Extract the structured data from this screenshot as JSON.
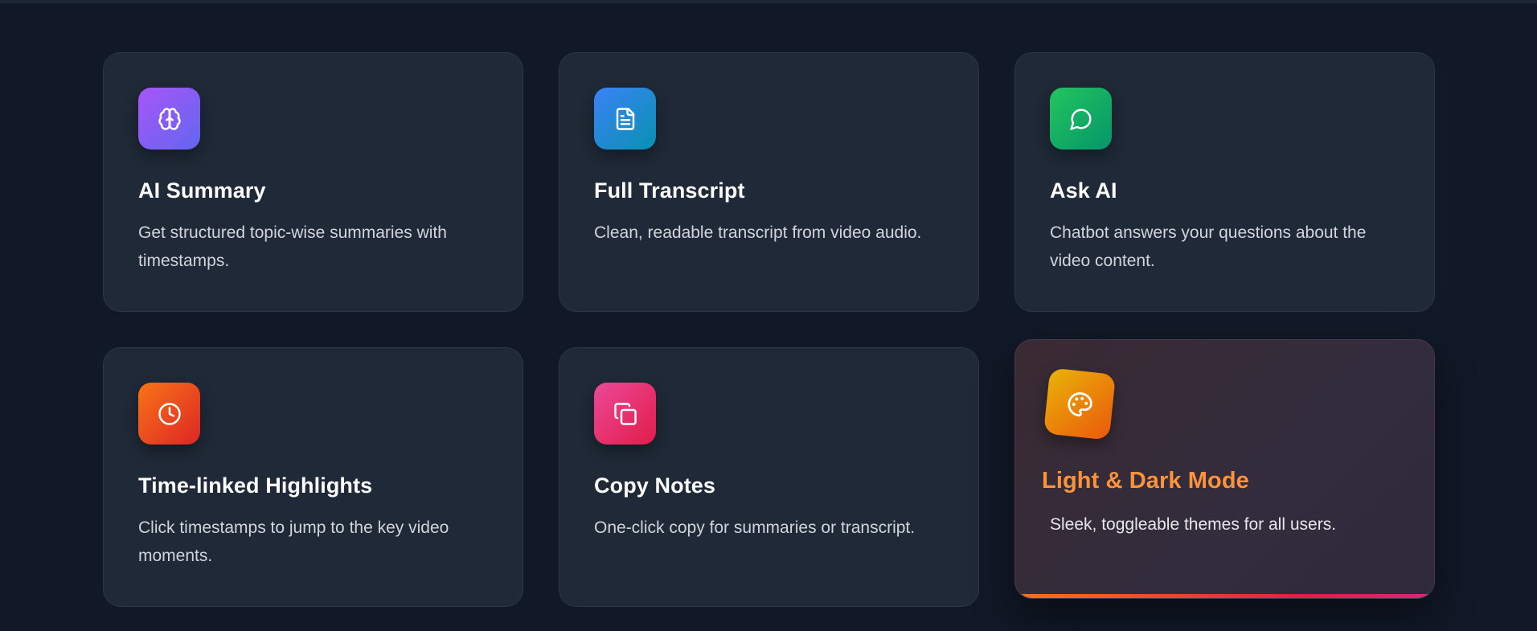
{
  "features": [
    {
      "title": "AI Summary",
      "description": "Get structured topic-wise summaries with timestamps.",
      "icon": "brain-icon",
      "gradient": [
        "#a855f7",
        "#6366f1"
      ]
    },
    {
      "title": "Full Transcript",
      "description": "Clean, readable transcript from video audio.",
      "icon": "document-icon",
      "gradient": [
        "#3b82f6",
        "#0891b2"
      ]
    },
    {
      "title": "Ask AI",
      "description": "Chatbot answers your questions about the video content.",
      "icon": "chat-bubble-icon",
      "gradient": [
        "#22c55e",
        "#059669"
      ]
    },
    {
      "title": "Time-linked Highlights",
      "description": "Click timestamps to jump to the key video moments.",
      "icon": "clock-icon",
      "gradient": [
        "#f97316",
        "#dc2626"
      ]
    },
    {
      "title": "Copy Notes",
      "description": "One-click copy for summaries or transcript.",
      "icon": "copy-icon",
      "gradient": [
        "#ec4899",
        "#e11d48"
      ]
    },
    {
      "title": "Light & Dark Mode",
      "description": "Sleek, toggleable themes for all users.",
      "icon": "palette-icon",
      "gradient": [
        "#eab308",
        "#ea580c"
      ]
    }
  ],
  "colors": {
    "page_background": "#111827",
    "card_background": "#1f2937",
    "hover_title": "#fb923c",
    "hover_bar": [
      "#f97316",
      "#e11d48",
      "#db2777"
    ]
  }
}
